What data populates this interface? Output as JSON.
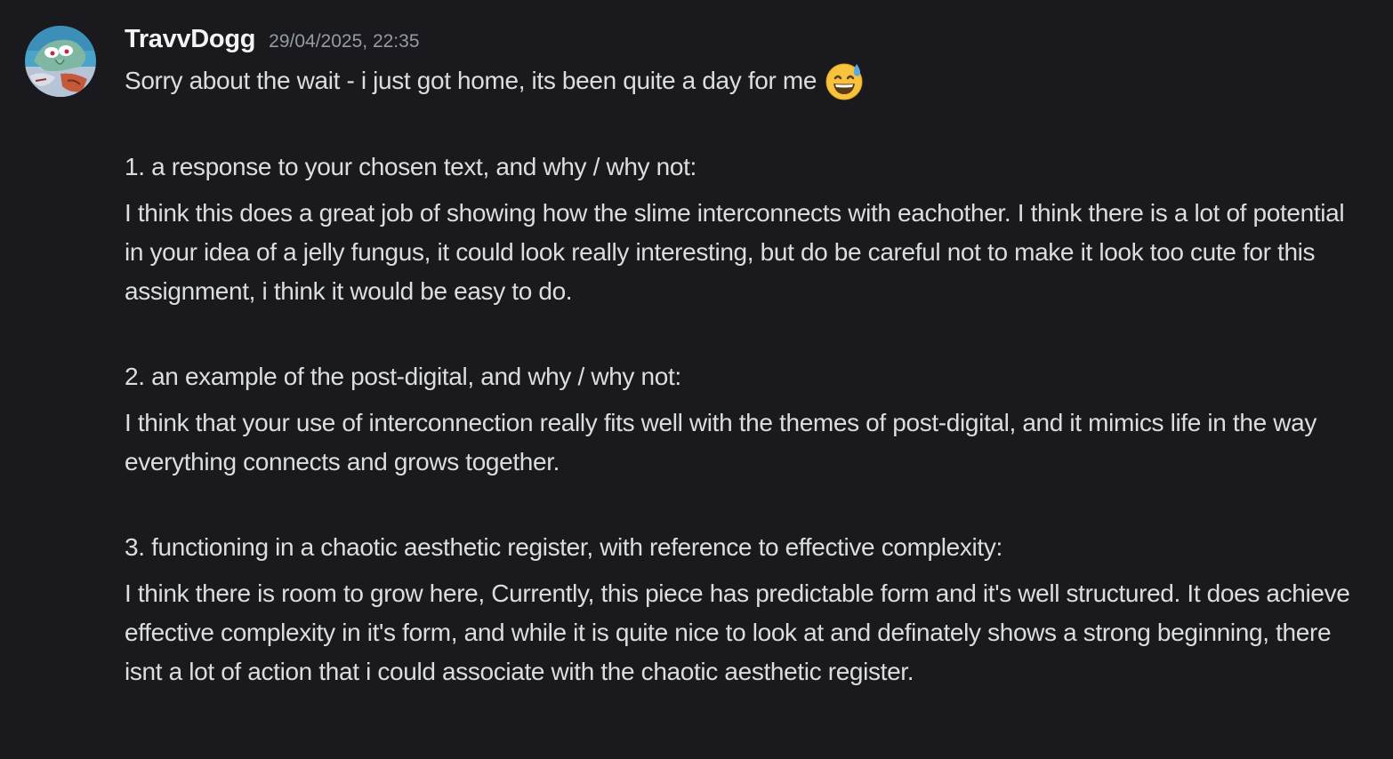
{
  "message": {
    "username": "TravvDogg",
    "timestamp": "29/04/2025, 22:35",
    "avatar_icon": "cartoon-character-avatar-icon",
    "first_line": "Sorry about the wait - i just got home, its been quite a day for me",
    "emoji": "grinning-face-with-sweat-emoji",
    "sections": [
      {
        "title": "1. a response to your chosen text, and why / why not:",
        "body": "I think this does a great job of showing how the slime interconnects with eachother. I think there is a lot of potential in your idea of a jelly fungus, it could look really interesting, but do be careful not to make it look too cute for this assignment, i think it would be easy to do."
      },
      {
        "title": "2. an example of the post-digital, and why / why not:",
        "body": "I think that your use of interconnection really fits well with the themes of post-digital, and it mimics life in the way everything connects and grows together."
      },
      {
        "title": "3. functioning in a chaotic aesthetic register, with reference to effective complexity:",
        "body": "I think there is room to grow here, Currently, this piece has predictable form and it's well structured. It does achieve effective complexity in it's form, and while it is quite nice to look at and definately shows a strong beginning, there isnt a lot of action that i could associate with the chaotic aesthetic register."
      }
    ]
  },
  "colors": {
    "background": "#1a1a1e",
    "username": "#f2f3f5",
    "timestamp": "#949ba4",
    "text": "#dbdee1"
  }
}
